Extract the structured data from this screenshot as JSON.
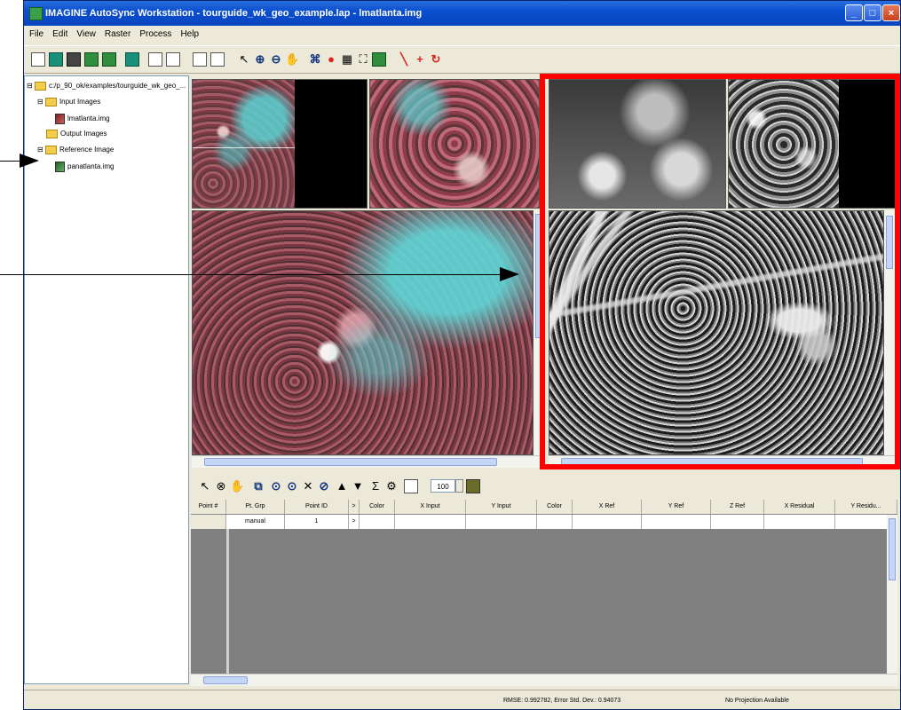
{
  "window": {
    "title": "IMAGINE AutoSync Workstation - tourguide_wk_geo_example.lap - lmatlanta.img",
    "buttons": [
      "_",
      "□",
      "×"
    ]
  },
  "menu": [
    "File",
    "Edit",
    "View",
    "Raster",
    "Process",
    "Help"
  ],
  "tree": {
    "root": "c:/p_90_ok/examples/tourguide_wk_geo_...",
    "input_images": "Input Images",
    "input_file": "lmatlanta.img",
    "output_images": "Output Images",
    "reference_image": "Reference Image",
    "reference_file": "panatlanta.img"
  },
  "gcp_toolbar": {
    "zoom_value": "100"
  },
  "gcp_table": {
    "headers": [
      "Point #",
      "Pt. Grp",
      "Point ID",
      ">",
      "Color",
      "X Input",
      "Y Input",
      "Color",
      "X Ref",
      "Y Ref",
      "Z Ref",
      "X Residual",
      "Y Residu..."
    ],
    "row": [
      "",
      "manual",
      "1",
      ">",
      "",
      "",
      "",
      "",
      "",
      "",
      "",
      "",
      ""
    ]
  },
  "status": {
    "rmse": "RMSE: 0.992782, Error Std. Dev.: 0.94073",
    "projection": "No Projection Available"
  },
  "colors": {
    "highlight": "#ff0000",
    "title_bar": "#0a4fcf"
  }
}
